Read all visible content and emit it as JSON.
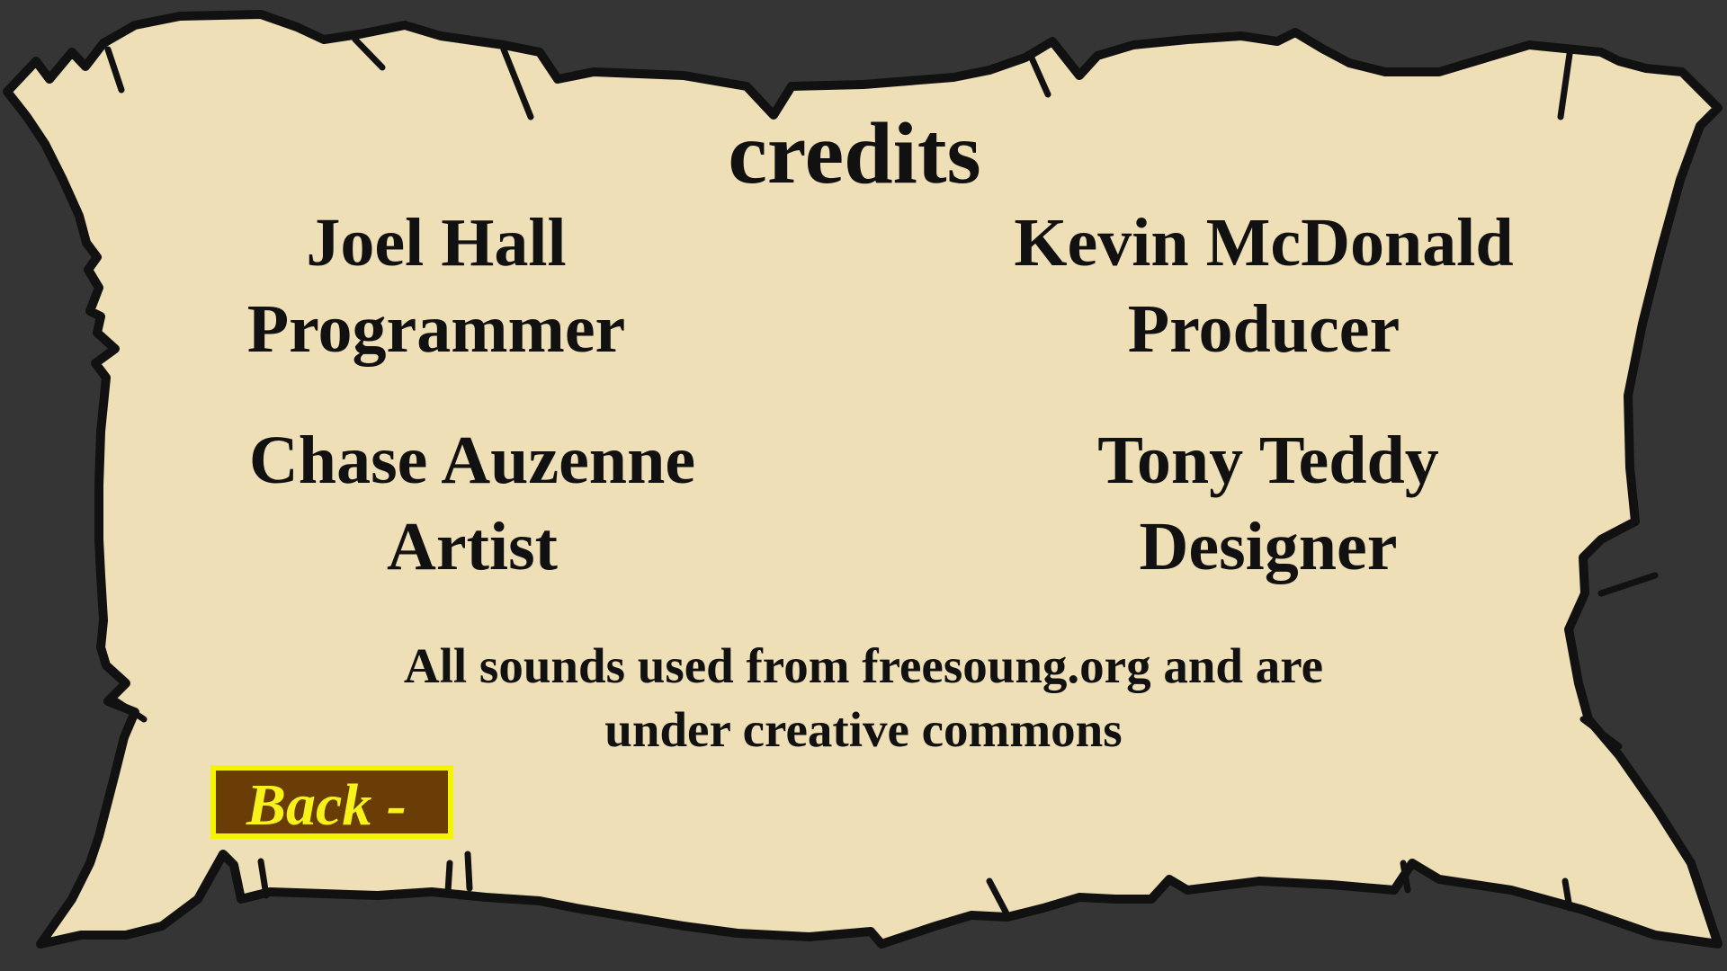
{
  "screen": {
    "title": "credits",
    "credits": [
      {
        "name": "Joel Hall",
        "role": "Programmer"
      },
      {
        "name": "Kevin McDonald",
        "role": "Producer"
      },
      {
        "name": "Chase Auzenne",
        "role": "Artist"
      },
      {
        "name": "Tony Teddy",
        "role": "Designer"
      }
    ],
    "note_line_1": "All sounds used from freesoung.org and are",
    "note_line_2": "under creative commons",
    "back_label": "Back -"
  },
  "colors": {
    "background": "#353535",
    "parchment": "#efdfb7",
    "outline": "#111111",
    "button_fill": "#6b3d06",
    "button_border": "#f4f400",
    "button_text": "#f6f21a"
  }
}
